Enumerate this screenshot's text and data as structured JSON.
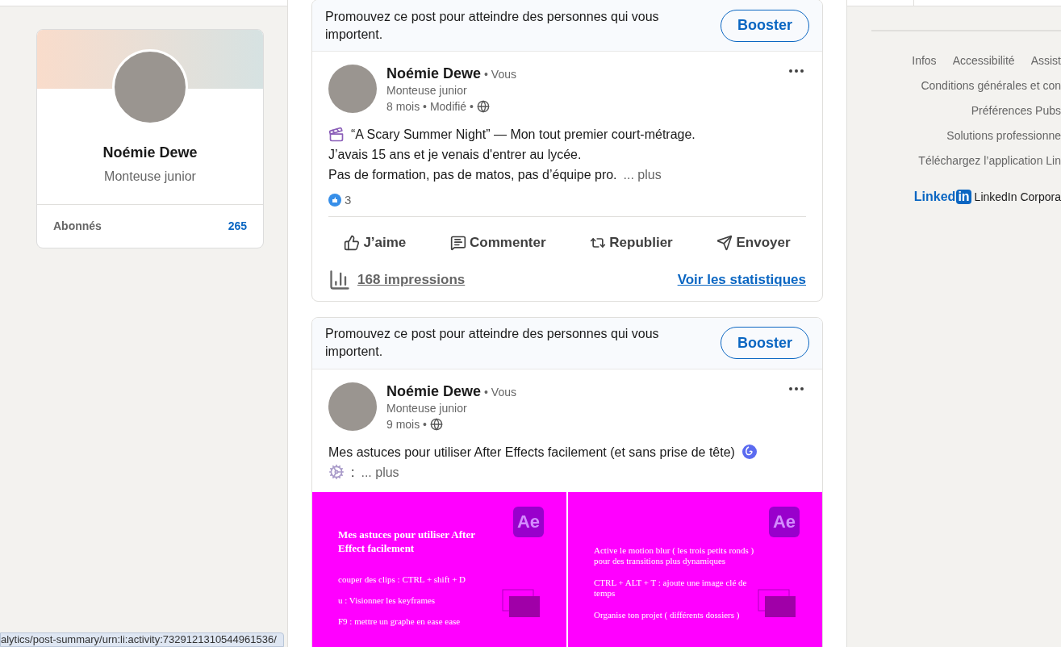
{
  "profile_card": {
    "name": "Noémie Dewe",
    "headline": "Monteuse junior",
    "stats": [
      {
        "label": "Abonnés",
        "value": "265"
      }
    ]
  },
  "posts": [
    {
      "promo": {
        "text": "Promouvez ce post pour atteindre des personnes qui vous importent.",
        "button": "Booster"
      },
      "author": "Noémie Dewe",
      "badge": "• Vous",
      "headline": "Monteuse junior",
      "meta": "8 mois • Modifié •",
      "lines": [
        {
          "segments": [
            {
              "kind": "clapper"
            },
            {
              "kind": "text",
              "text": "“A Scary Summer Night” — Mon tout premier court-métrage."
            }
          ]
        },
        {
          "segments": [
            {
              "kind": "text",
              "text": "J’avais 15 ans et je venais d'entrer au lycée."
            }
          ]
        },
        {
          "segments": [
            {
              "kind": "text",
              "text": "Pas de formation, pas de matos, pas d’équipe pro."
            },
            {
              "kind": "more",
              "text": "... plus"
            }
          ]
        }
      ],
      "reactions": "3",
      "actions": [
        {
          "kind": "like",
          "label": "J’aime"
        },
        {
          "kind": "comment",
          "label": "Commenter"
        },
        {
          "kind": "repost",
          "label": "Republier"
        },
        {
          "kind": "send",
          "label": "Envoyer"
        }
      ],
      "impressions": "168 impressions",
      "stats_link": "Voir les statistiques"
    },
    {
      "promo": {
        "text": "Promouvez ce post pour atteindre des personnes qui vous importent.",
        "button": "Booster"
      },
      "author": "Noémie Dewe",
      "badge": "• Vous",
      "headline": "Monteuse junior",
      "meta": "9 mois •",
      "lines": [
        {
          "segments": [
            {
              "kind": "text",
              "text": "Mes astuces pour utiliser After Effects facilement (et sans prise de tête)"
            },
            {
              "kind": "spiral"
            }
          ]
        },
        {
          "segments": [
            {
              "kind": "gear"
            },
            {
              "kind": "text",
              "text": ":"
            },
            {
              "kind": "more",
              "text": "... plus"
            }
          ]
        }
      ],
      "slides": [
        {
          "logo": "Ae",
          "title": "Mes astuces pour utiliser After Effect facilement",
          "items": [
            "couper des clips : CTRL + shift + D",
            "u : Visionner les keyframes",
            "F9 : mettre un graphe en ease ease"
          ]
        },
        {
          "logo": "Ae",
          "items": [
            "Active le motion blur ( les trois petits ronds ) pour des transitions plus dynamiques",
            "CTRL + ALT + T : ajoute une image clé de temps",
            "Organise ton projet ( différents dossiers )"
          ]
        }
      ]
    }
  ],
  "footer": {
    "rows": [
      [
        "Infos",
        "Accessibilité",
        "Assist"
      ],
      [
        "Conditions générales et con"
      ],
      [
        "Préférences Pubs"
      ],
      [
        "Solutions professionne"
      ],
      [
        "Téléchargez l’application Lin"
      ]
    ],
    "logo_word": "Linked",
    "logo_box": "in",
    "company": "LinkedIn Corpora"
  },
  "status_url": "alytics/post-summary/urn:li:activity:7329121310544961536/"
}
